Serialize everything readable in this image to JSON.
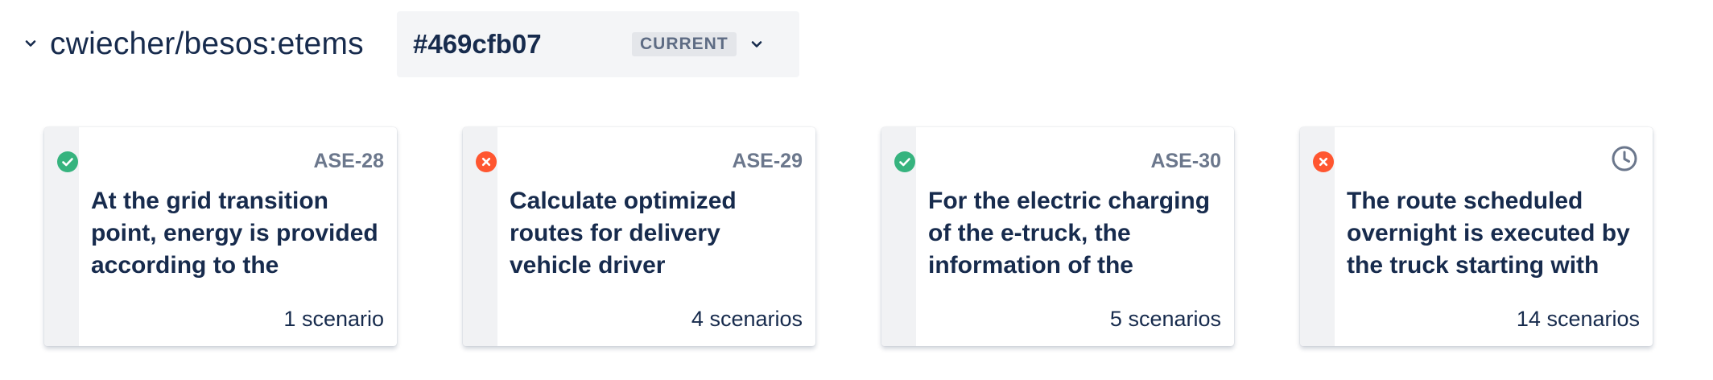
{
  "header": {
    "repo_title": "cwiecher/besos:etems",
    "version": {
      "hash": "#469cfb07",
      "badge": "CURRENT"
    }
  },
  "colors": {
    "passed": "#36b37e",
    "failed": "#ff5630",
    "text": "#172b4d",
    "muted": "#6b778c"
  },
  "cards": [
    {
      "key": "ASE-28",
      "title": "At the grid transition point, energy is provided according to the",
      "scenarios": "1 scenario",
      "status": "passed",
      "status_icon": "check-circle-icon"
    },
    {
      "key": "ASE-29",
      "title": "Calculate optimized routes for delivery vehicle driver",
      "scenarios": "4 scenarios",
      "status": "failed",
      "status_icon": "cross-circle-icon"
    },
    {
      "key": "ASE-30",
      "title": "For the electric charging of the e-truck, the information of the",
      "scenarios": "5 scenarios",
      "status": "passed",
      "status_icon": "check-circle-icon"
    },
    {
      "key": "",
      "title": "The route scheduled overnight is executed by the truck starting with",
      "scenarios": "14 scenarios",
      "status": "failed",
      "status_icon": "cross-circle-icon",
      "key_icon": "clock-icon"
    }
  ]
}
